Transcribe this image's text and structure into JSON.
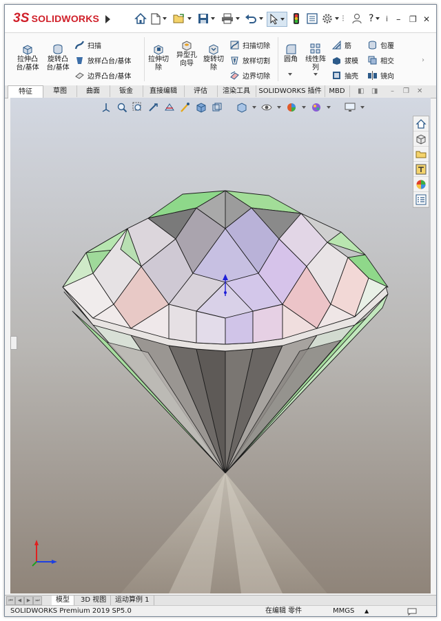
{
  "app": {
    "logo_prefix": "3S",
    "logo_text": "SOLIDWORKS",
    "window_controls": {
      "minimize": "–",
      "restore": "❐",
      "close": "✕"
    },
    "help_label": "?",
    "info_label": "i"
  },
  "ribbon": {
    "extrude_boss": "拉伸凸台/基体",
    "revolve_boss": "旋转凸台/基体",
    "sweep": "扫描",
    "loft_boss": "放样凸台/基体",
    "boundary_boss": "边界凸台/基体",
    "extrude_cut": "拉伸切除",
    "hole_wizard": "异型孔向导",
    "revolve_cut": "旋转切除",
    "swept_cut": "扫描切除",
    "lofted_cut": "放样切割",
    "boundary_cut": "边界切除",
    "fillet": "圆角",
    "linear_pattern": "线性阵列",
    "rib": "筋",
    "draft": "拔模",
    "shell": "抽壳",
    "wrap": "包覆",
    "intersect": "相交",
    "mirror": "镜向"
  },
  "tabs": [
    {
      "label": "特征",
      "active": true
    },
    {
      "label": "草图",
      "active": false
    },
    {
      "label": "曲面",
      "active": false
    },
    {
      "label": "钣金",
      "active": false
    },
    {
      "label": "直接编辑",
      "active": false
    },
    {
      "label": "评估",
      "active": false
    },
    {
      "label": "渲染工具",
      "active": false
    },
    {
      "label": "SOLIDWORKS 插件",
      "active": false
    },
    {
      "label": "MBD",
      "active": false
    }
  ],
  "bottom_tabs": [
    {
      "label": "模型",
      "active": true
    },
    {
      "label": "3D 视图",
      "active": false
    },
    {
      "label": "运动算例 1",
      "active": false
    }
  ],
  "status": {
    "version": "SOLIDWORKS Premium 2019 SP5.0",
    "mode": "在编辑 零件",
    "units": "MMGS",
    "units_arrow": "▲"
  },
  "colors": {
    "brand": "#d0202a",
    "facet_green": "#7fe08a",
    "facet_pink": "#e8c2c0",
    "facet_violet": "#b9a6e8"
  },
  "icons": {
    "quick_access": [
      "home-icon",
      "new-document-icon",
      "open-icon",
      "save-icon",
      "print-icon",
      "undo-icon",
      "select-arrow-icon",
      "traffic-light-icon",
      "file-properties-icon",
      "options-gear-icon",
      "user-icon"
    ],
    "heads_up": [
      "view-orientation-icon",
      "zoom-to-fit-icon",
      "zoom-to-area-icon",
      "previous-view-icon",
      "section-view-icon",
      "dynamic-annotation-icon",
      "view-cube-icon",
      "display-style-icon",
      "hide-show-icon",
      "edit-appearance-icon",
      "scene-icon",
      "view-settings-icon"
    ],
    "task_pane": [
      "home-icon",
      "3d-parts-icon",
      "file-explorer-icon",
      "view-palette-icon",
      "appearances-icon",
      "custom-properties-icon"
    ]
  }
}
